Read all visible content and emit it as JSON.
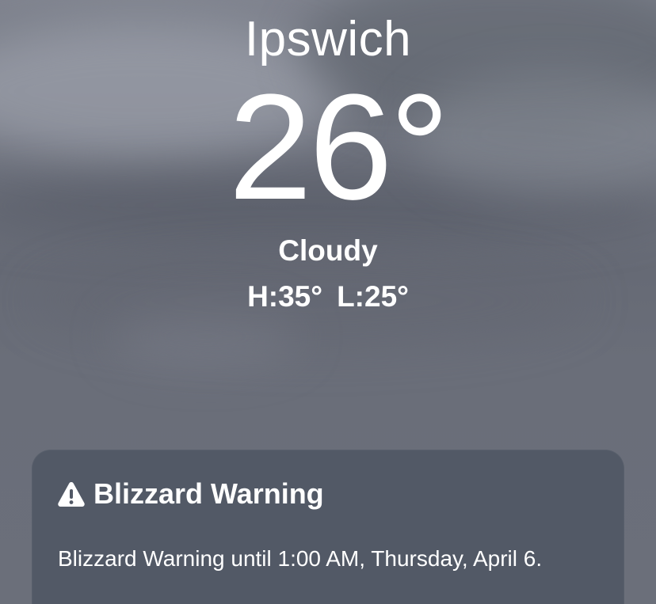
{
  "weather": {
    "city": "Ipswich",
    "temperature": "26°",
    "condition": "Cloudy",
    "high": "H:35°",
    "low": "L:25°"
  },
  "alert": {
    "icon": "warning-triangle-icon",
    "title": "Blizzard Warning",
    "description": "Blizzard Warning until 1:00 AM, Thursday, April 6."
  },
  "colors": {
    "background": "#6e727d",
    "card": "#4f5663",
    "text": "#ffffff"
  }
}
